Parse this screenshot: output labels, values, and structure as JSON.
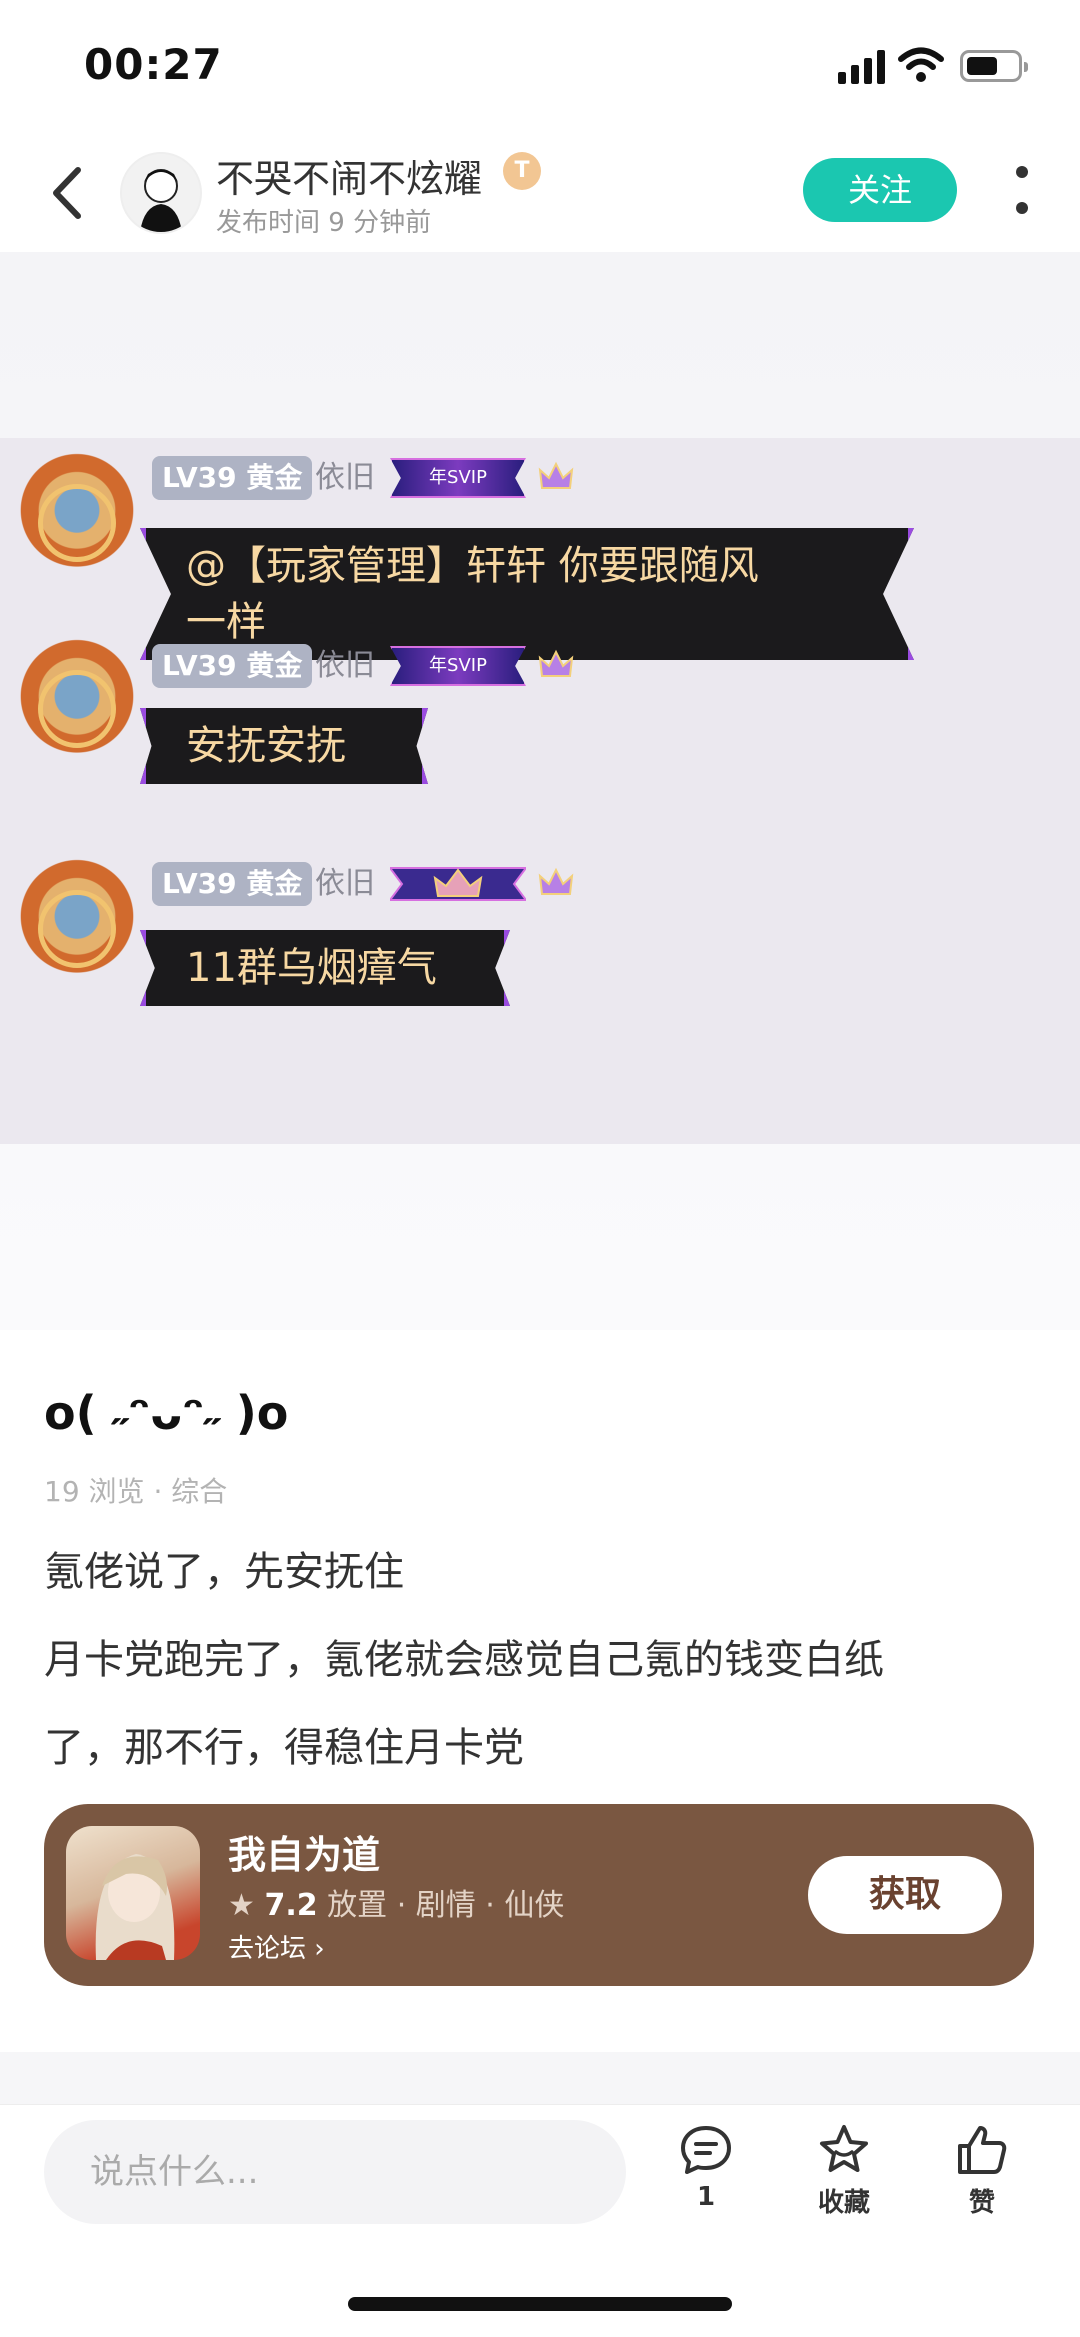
{
  "status_bar": {
    "time": "00:27"
  },
  "header": {
    "author_name": "不哭不闹不炫耀",
    "badge": "T",
    "publish_time": "发布时间 9 分钟前",
    "follow_label": "关注"
  },
  "chat": {
    "messages": [
      {
        "level": "LV39 黄金",
        "nickname": "依旧",
        "title_tag": "年SVIP",
        "text": "@【玩家管理】轩轩 你要跟随风\n一样"
      },
      {
        "level": "LV39 黄金",
        "nickname": "依旧",
        "title_tag": "年SVIP",
        "text": "安抚安抚"
      },
      {
        "level": "LV39 黄金",
        "nickname": "依旧",
        "title_tag": "",
        "text": "11群乌烟瘴气"
      }
    ]
  },
  "post": {
    "title": "o( ˶ᵔᴗᵔ˶ )o",
    "views": "19 浏览",
    "category": "综合",
    "lines": [
      "氪佬说了，先安抚住",
      "月卡党跑完了，氪佬就会感觉自己氪的钱变白纸",
      "了，那不行，得稳住月卡党"
    ]
  },
  "game_card": {
    "name": "我自为道",
    "rating": "7.2",
    "tags": "放置 · 剧情 · 仙侠",
    "forum_link": "去论坛",
    "get_label": "获取"
  },
  "bottom_bar": {
    "comment_placeholder": "说点什么...",
    "comment_count": "1",
    "favorite_label": "收藏",
    "like_label": "赞"
  },
  "colors": {
    "accent": "#1bc7b0",
    "game_card_bg": "#7a5741"
  }
}
